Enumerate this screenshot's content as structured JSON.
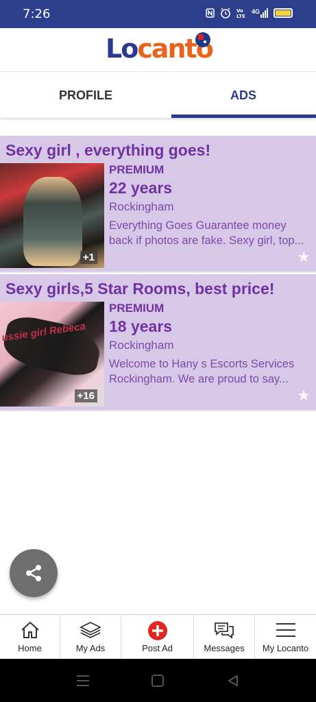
{
  "status_bar": {
    "time": "7:26",
    "icons": [
      "nfc-icon",
      "alarm-icon",
      "volte-icon",
      "signal-4g-icon",
      "battery-icon"
    ],
    "network_label": "4G"
  },
  "header": {
    "logo_text_part1": "Lo",
    "logo_text_part2": "canto",
    "region_flag": "australia-flag-icon",
    "brand_blue": "#2b3a8f",
    "brand_orange": "#e8641c"
  },
  "tabs": [
    {
      "label": "PROFILE",
      "active": false
    },
    {
      "label": "ADS",
      "active": true
    }
  ],
  "ads": [
    {
      "title": "Sexy girl , everything goes!",
      "badge": "PREMIUM",
      "age": "22 years",
      "location": "Rockingham",
      "description": "Everything Goes Guarantee money back if photos are fake. Sexy girl, top...",
      "photo_count": "+1"
    },
    {
      "title": "Sexy girls,5 Star Rooms, best price!",
      "badge": "PREMIUM",
      "age": "18 years",
      "location": "Rockingham",
      "description": "Welcome to Hany s Escorts Services Rockingham. We are proud to say...",
      "photo_count": "+16",
      "watermark": "ussie girl Rebeca"
    }
  ],
  "colors": {
    "ad_background": "#d8c8e8",
    "ad_text": "#7032a0",
    "status_bar": "#2c3e8c"
  },
  "bottom_nav": [
    {
      "label": "Home",
      "icon": "home-icon"
    },
    {
      "label": "My Ads",
      "icon": "stack-icon"
    },
    {
      "label": "Post Ad",
      "icon": "plus-circle-icon"
    },
    {
      "label": "Messages",
      "icon": "chat-icon"
    },
    {
      "label": "My Locanto",
      "icon": "menu-icon"
    }
  ]
}
